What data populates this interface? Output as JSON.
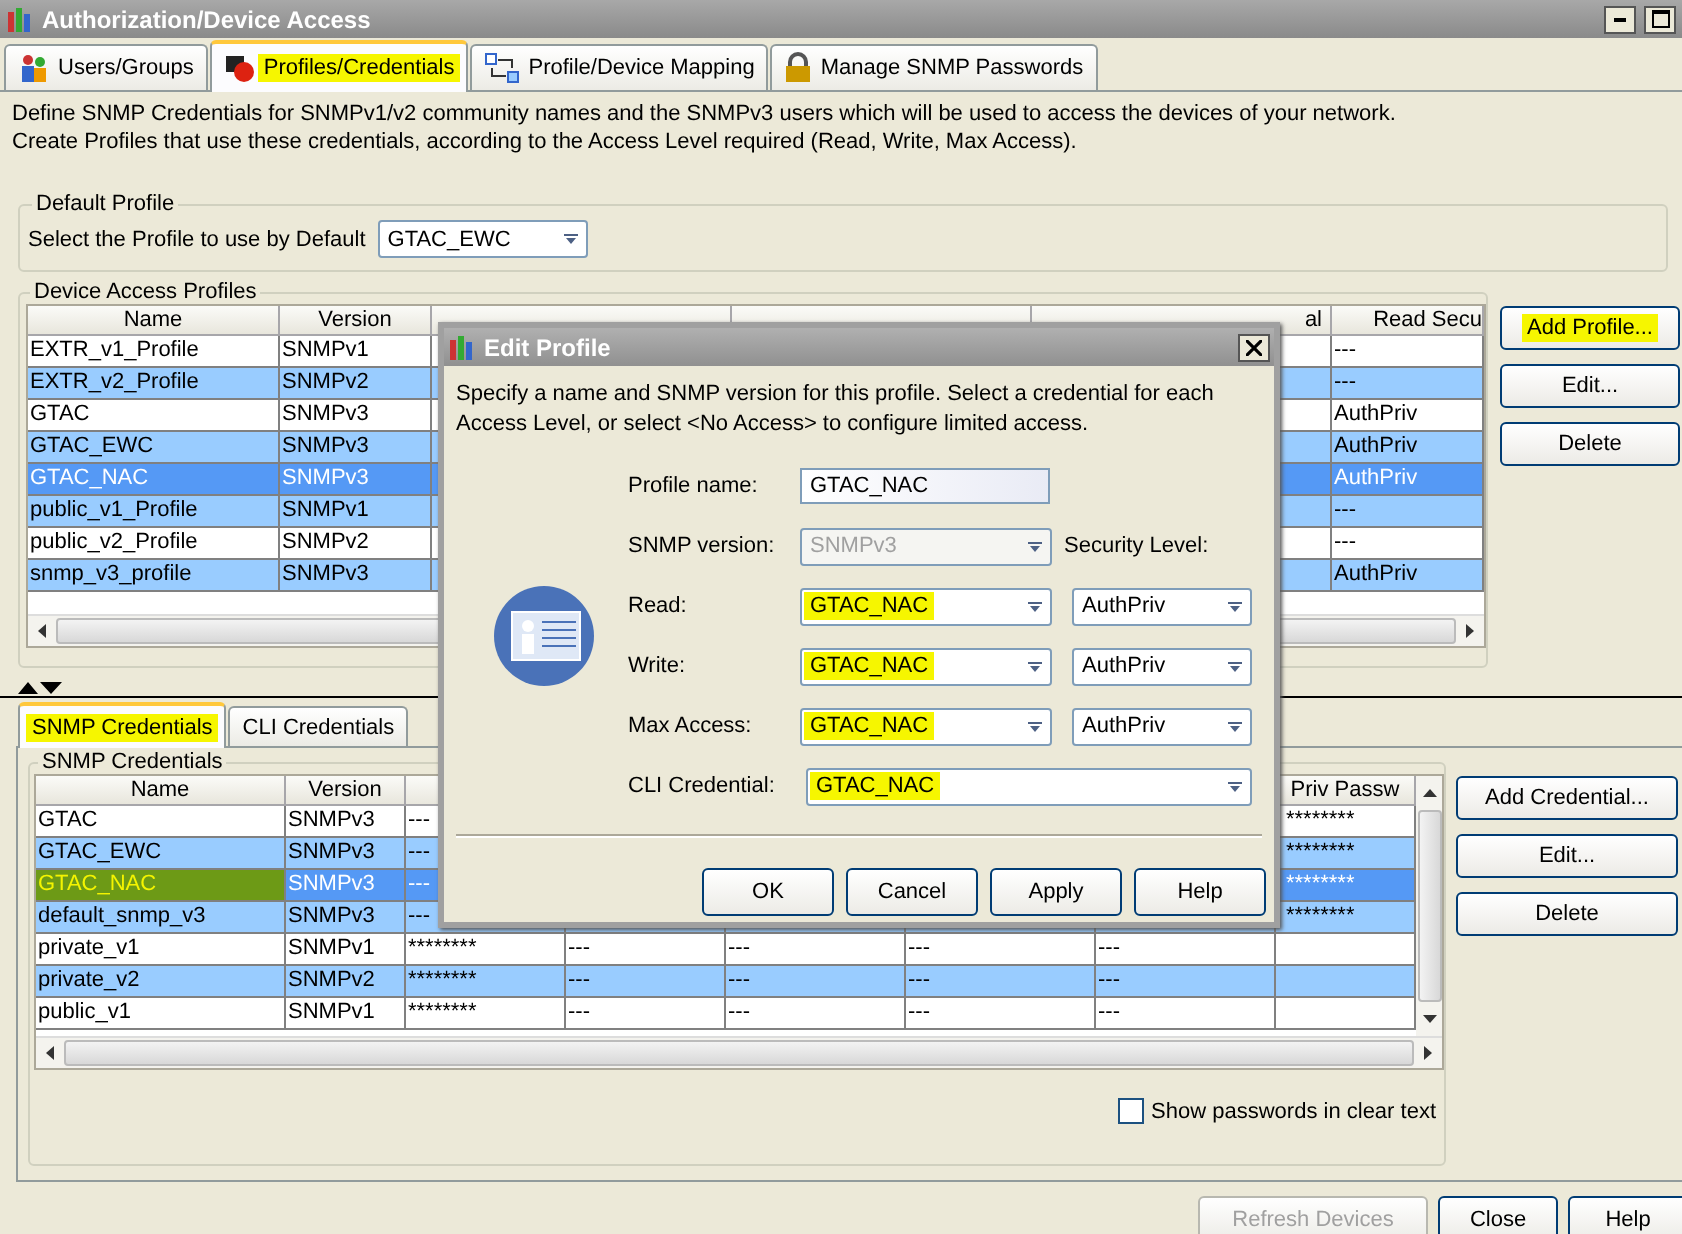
{
  "window": {
    "title": "Authorization/Device Access"
  },
  "tabs": [
    {
      "label": "Users/Groups",
      "selected": false,
      "highlighted": false
    },
    {
      "label": "Profiles/Credentials",
      "selected": true,
      "highlighted": true
    },
    {
      "label": "Profile/Device Mapping",
      "selected": false,
      "highlighted": false
    },
    {
      "label": "Manage SNMP Passwords",
      "selected": false,
      "highlighted": false
    }
  ],
  "description": [
    "Define SNMP Credentials for SNMPv1/v2 community names and the SNMPv3 users which will be used to access the devices of your network.",
    "Create Profiles that use these credentials, according to the Access Level required (Read, Write, Max Access)."
  ],
  "default_profile": {
    "title": "Default Profile",
    "label": "Select the Profile to use by Default",
    "value": "GTAC_EWC"
  },
  "profiles": {
    "title": "Device Access Profiles",
    "columns": {
      "name": "Name",
      "version": "Version",
      "column_5": "al",
      "read_security": "Read Secu"
    },
    "rows": [
      {
        "name": "EXTR_v1_Profile",
        "version": "SNMPv1",
        "read_security": "---",
        "selected": false
      },
      {
        "name": "EXTR_v2_Profile",
        "version": "SNMPv2",
        "read_security": "---",
        "selected": false
      },
      {
        "name": "GTAC",
        "version": "SNMPv3",
        "read_security": "AuthPriv",
        "selected": false
      },
      {
        "name": "GTAC_EWC",
        "version": "SNMPv3",
        "read_security": "AuthPriv",
        "selected": false
      },
      {
        "name": "GTAC_NAC",
        "version": "SNMPv3",
        "read_security": "AuthPriv",
        "selected": true
      },
      {
        "name": "public_v1_Profile",
        "version": "SNMPv1",
        "read_security": "---",
        "selected": false
      },
      {
        "name": "public_v2_Profile",
        "version": "SNMPv2",
        "read_security": "---",
        "selected": false
      },
      {
        "name": "snmp_v3_profile",
        "version": "SNMPv3",
        "read_security": "AuthPriv",
        "selected": false
      }
    ],
    "buttons": [
      {
        "label": "Add Profile...",
        "highlighted": true
      },
      {
        "label": "Edit...",
        "highlighted": false
      },
      {
        "label": "Delete",
        "highlighted": false
      }
    ]
  },
  "lower_tabs": [
    {
      "label": "SNMP Credentials",
      "selected": true,
      "highlighted": true
    },
    {
      "label": "CLI Credentials",
      "selected": false,
      "highlighted": false
    }
  ],
  "credentials": {
    "title": "SNMP Credentials",
    "columns": {
      "name": "Name",
      "version": "Version",
      "priv_password": "Priv Passw"
    },
    "rows": [
      {
        "name": "GTAC",
        "version": "SNMPv3",
        "column_3": "---",
        "priv_password": "********",
        "selected": false,
        "highlighted": false
      },
      {
        "name": "GTAC_EWC",
        "version": "SNMPv3",
        "column_3": "---",
        "priv_password": "********",
        "selected": false,
        "highlighted": false
      },
      {
        "name": "GTAC_NAC",
        "version": "SNMPv3",
        "column_3": "---",
        "priv_password": "********",
        "selected": true,
        "highlighted": true
      },
      {
        "name": "default_snmp_v3",
        "version": "SNMPv3",
        "column_3": "---",
        "priv_password": "********",
        "selected": false,
        "highlighted": false
      },
      {
        "name": "private_v1",
        "version": "SNMPv1",
        "column_3": "********",
        "column_4": "---",
        "column_5": "---",
        "column_6": "---",
        "column_7": "---",
        "selected": false,
        "highlighted": false
      },
      {
        "name": "private_v2",
        "version": "SNMPv2",
        "column_3": "********",
        "column_4": "---",
        "column_5": "---",
        "column_6": "---",
        "column_7": "---",
        "selected": false,
        "highlighted": false
      },
      {
        "name": "public_v1",
        "version": "SNMPv1",
        "column_3": "********",
        "column_4": "---",
        "column_5": "---",
        "column_6": "---",
        "column_7": "---",
        "selected": false,
        "highlighted": false
      }
    ],
    "buttons": [
      {
        "label": "Add Credential..."
      },
      {
        "label": "Edit..."
      },
      {
        "label": "Delete"
      }
    ],
    "show_passwords": {
      "label": "Show passwords in clear text",
      "checked": false
    }
  },
  "footer_buttons": [
    {
      "label": "Refresh Devices",
      "disabled": true
    },
    {
      "label": "Close",
      "disabled": false
    },
    {
      "label": "Help",
      "disabled": false
    }
  ],
  "dialog": {
    "title": "Edit Profile",
    "description": "Specify a name and SNMP version for this profile.  Select a credential for each Access Level, or select <No Access> to configure limited access.",
    "profile_name": {
      "label": "Profile name:",
      "value": "GTAC_NAC"
    },
    "snmp_version": {
      "label": "SNMP version:",
      "value": "SNMPv3",
      "disabled": true
    },
    "security_label": "Security Level:",
    "access": [
      {
        "label": "Read:",
        "credential": "GTAC_NAC",
        "security": "AuthPriv",
        "highlighted": true
      },
      {
        "label": "Write:",
        "credential": "GTAC_NAC",
        "security": "AuthPriv",
        "highlighted": true
      },
      {
        "label": "Max Access:",
        "credential": "GTAC_NAC",
        "security": "AuthPriv",
        "highlighted": true
      }
    ],
    "cli_credential": {
      "label": "CLI Credential:",
      "value": "GTAC_NAC",
      "highlighted": true
    },
    "buttons": [
      {
        "label": "OK"
      },
      {
        "label": "Cancel"
      },
      {
        "label": "Apply"
      },
      {
        "label": "Help"
      }
    ]
  }
}
